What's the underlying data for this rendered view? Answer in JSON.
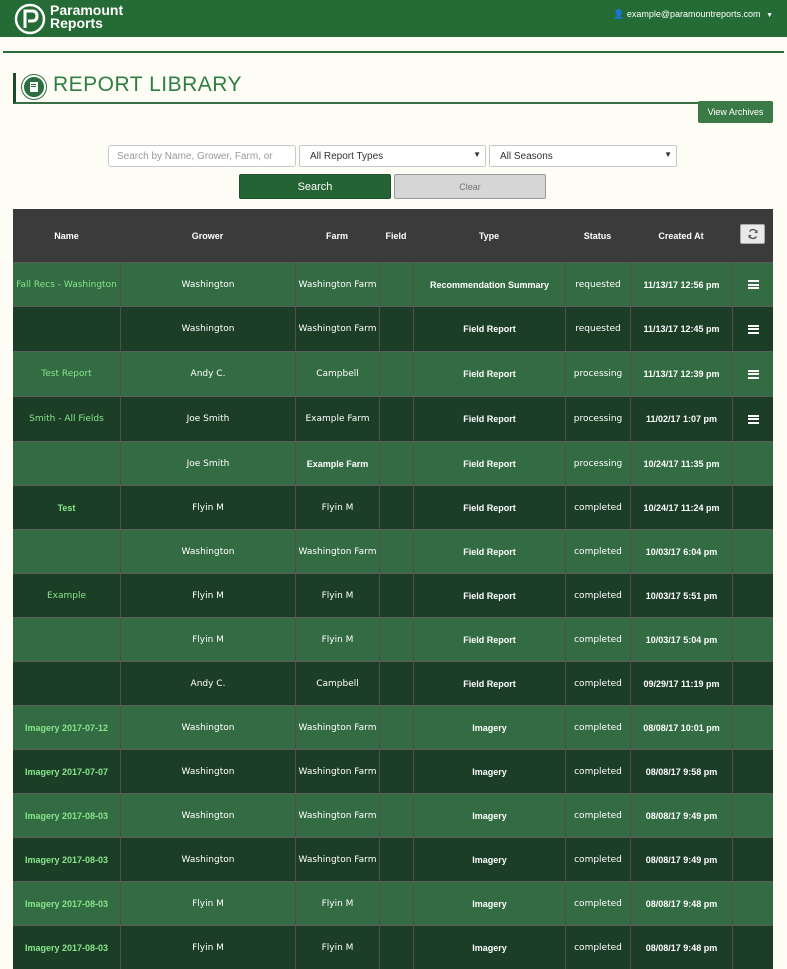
{
  "header": {
    "brand_line1": "Paramount",
    "brand_line2": "Reports",
    "user_email": "example@paramountreports.com"
  },
  "page": {
    "title": "REPORT LIBRARY",
    "view_archives": "View Archives"
  },
  "filters": {
    "search_placeholder": "Search by Name, Grower, Farm, or",
    "report_type": "All Report Types",
    "season": "All Seasons",
    "search_button": "Search",
    "clear_button": "Clear"
  },
  "table": {
    "columns": {
      "name": "Name",
      "grower": "Grower",
      "farm": "Farm",
      "field": "Field",
      "type": "Type",
      "status": "Status",
      "created": "Created At"
    },
    "rows": [
      {
        "name": "Fall Recs - Washington",
        "grower": "Washington",
        "farm": "Washington Farm",
        "type": "Recommendation Summary",
        "status": "requested",
        "created": "11/13/17 12:56 pm",
        "menu": true
      },
      {
        "name": "",
        "grower": "Washington",
        "farm": "Washington Farm",
        "type": "Field Report",
        "status": "requested",
        "created": "11/13/17 12:45 pm",
        "menu": true
      },
      {
        "name": "Test Report",
        "grower": "Andy C.",
        "farm": "Campbell",
        "type": "Field Report",
        "status": "processing",
        "created": "11/13/17 12:39 pm",
        "menu": true
      },
      {
        "name": "Smith - All Fields",
        "grower": "Joe Smith",
        "farm": "Example Farm",
        "type": "Field Report",
        "status": "processing",
        "created": "11/02/17 1:07 pm",
        "menu": true
      },
      {
        "name": "",
        "grower": "Joe Smith",
        "farm": "Example Farm",
        "type": "Field Report",
        "status": "processing",
        "created": "10/24/17 11:35 pm",
        "menu": false
      },
      {
        "name": "Test",
        "grower": "Flyin M",
        "farm": "Flyin M",
        "type": "Field Report",
        "status": "completed",
        "created": "10/24/17 11:24 pm",
        "menu": false
      },
      {
        "name": "",
        "grower": "Washington",
        "farm": "Washington Farm",
        "type": "Field Report",
        "status": "completed",
        "created": "10/03/17 6:04 pm",
        "menu": false
      },
      {
        "name": "Example",
        "grower": "Flyin M",
        "farm": "Flyin M",
        "type": "Field Report",
        "status": "completed",
        "created": "10/03/17 5:51 pm",
        "menu": false
      },
      {
        "name": "",
        "grower": "Flyin M",
        "farm": "Flyin M",
        "type": "Field Report",
        "status": "completed",
        "created": "10/03/17 5:04 pm",
        "menu": false
      },
      {
        "name": "",
        "grower": "Andy C.",
        "farm": "Campbell",
        "type": "Field Report",
        "status": "completed",
        "created": "09/29/17 11:19 pm",
        "menu": false
      },
      {
        "name": "Imagery 2017-07-12",
        "grower": "Washington",
        "farm": "Washington Farm",
        "type": "Imagery",
        "status": "completed",
        "created": "08/08/17 10:01 pm",
        "menu": false
      },
      {
        "name": "Imagery 2017-07-07",
        "grower": "Washington",
        "farm": "Washington Farm",
        "type": "Imagery",
        "status": "completed",
        "created": "08/08/17 9:58 pm",
        "menu": false
      },
      {
        "name": "Imagery 2017-08-03",
        "grower": "Washington",
        "farm": "Washington Farm",
        "type": "Imagery",
        "status": "completed",
        "created": "08/08/17 9:49 pm",
        "menu": false
      },
      {
        "name": "Imagery 2017-08-03",
        "grower": "Washington",
        "farm": "Washington Farm",
        "type": "Imagery",
        "status": "completed",
        "created": "08/08/17 9:49 pm",
        "menu": false
      },
      {
        "name": "Imagery 2017-08-03",
        "grower": "Flyin M",
        "farm": "Flyin M",
        "type": "Imagery",
        "status": "completed",
        "created": "08/08/17 9:48 pm",
        "menu": false
      },
      {
        "name": "Imagery 2017-08-03",
        "grower": "Flyin M",
        "farm": "Flyin M",
        "type": "Imagery",
        "status": "completed",
        "created": "08/08/17 9:48 pm",
        "menu": false
      }
    ]
  },
  "colors": {
    "brand_green": "#256b35",
    "row_light": "#336b42",
    "row_dark": "#1c3e27",
    "name_link": "#86e68b"
  }
}
